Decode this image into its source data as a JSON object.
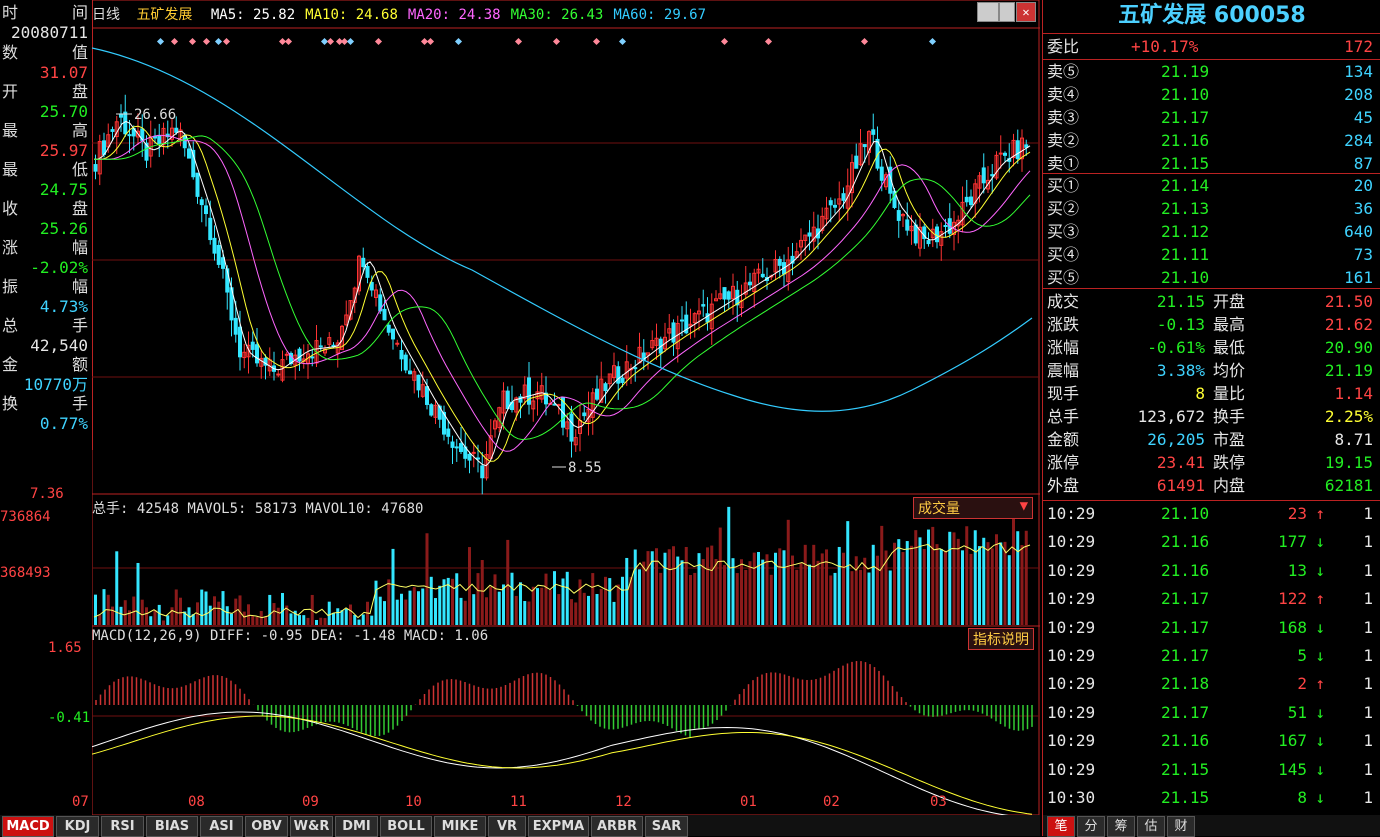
{
  "header": {
    "period": "日线",
    "stock_name": "五矿发展",
    "ma": [
      {
        "label": "MA5: 25.82",
        "color": "#ffffff"
      },
      {
        "label": "MA10: 24.68",
        "color": "#ffff33"
      },
      {
        "label": "MA20: 24.38",
        "color": "#ff66ff"
      },
      {
        "label": "MA30: 26.43",
        "color": "#33ff33"
      },
      {
        "label": "MA60: 29.67",
        "color": "#33ccff"
      }
    ]
  },
  "left_info": {
    "date_label": "时",
    "date_label2": "间",
    "date": "20080711",
    "rows": [
      {
        "lab": "数",
        "lab2": "值",
        "val": "",
        "color": "#ddd"
      },
      {
        "lab": "",
        "lab2": "",
        "val": "31.07",
        "color": "#ff4444"
      },
      {
        "lab": "开",
        "lab2": "盘",
        "val": "",
        "color": "#ddd"
      },
      {
        "lab": "",
        "lab2": "",
        "val": "25.70",
        "color": "#22ee22"
      },
      {
        "lab": "最",
        "lab2": "高",
        "val": "",
        "color": "#ddd"
      },
      {
        "lab": "",
        "lab2": "",
        "val": "25.97",
        "color": "#ff4444"
      },
      {
        "lab": "最",
        "lab2": "低",
        "val": "",
        "color": "#ddd"
      },
      {
        "lab": "",
        "lab2": "",
        "val": "24.75",
        "color": "#22ee22"
      },
      {
        "lab": "收",
        "lab2": "盘",
        "val": "",
        "color": "#ddd"
      },
      {
        "lab": "",
        "lab2": "",
        "val": "25.26",
        "color": "#22ee22"
      },
      {
        "lab": "涨",
        "lab2": "幅",
        "val": "",
        "color": "#ddd"
      },
      {
        "lab": "",
        "lab2": "",
        "val": "-2.02%",
        "color": "#22ee22"
      },
      {
        "lab": "振",
        "lab2": "幅",
        "val": "",
        "color": "#ddd"
      },
      {
        "lab": "",
        "lab2": "",
        "val": "4.73%",
        "color": "#3fd3ff"
      },
      {
        "lab": "总",
        "lab2": "手",
        "val": "",
        "color": "#ddd"
      },
      {
        "lab": "",
        "lab2": "",
        "val": "42,540",
        "color": "#e6e6e6"
      },
      {
        "lab": "金",
        "lab2": "额",
        "val": "",
        "color": "#ddd"
      },
      {
        "lab": "",
        "lab2": "",
        "val": "10770万",
        "color": "#3fd3ff"
      },
      {
        "lab": "换",
        "lab2": "手",
        "val": "",
        "color": "#ddd"
      },
      {
        "lab": "",
        "lab2": "",
        "val": "0.77%",
        "color": "#3fd3ff"
      }
    ]
  },
  "price_chart": {
    "high_mark": "26.66",
    "low_mark": "8.55",
    "y_bottom_label": "7.36"
  },
  "volume": {
    "legend": "总手: 42548  MAVOL5: 58173  MAVOL10: 47680",
    "selector": "成交量",
    "ticks": [
      "736864",
      "368493"
    ]
  },
  "macd": {
    "legend": "MACD(12,26,9)  DIFF: -0.95  DEA: -1.48  MACD: 1.06",
    "button": "指标说明",
    "ticks": [
      "1.65",
      "-0.41"
    ]
  },
  "x_axis": [
    "07",
    "08",
    "09",
    "10",
    "11",
    "12",
    "01",
    "02",
    "03"
  ],
  "tabs": [
    "MACD",
    "KDJ",
    "RSI",
    "BIAS",
    "ASI",
    "OBV",
    "W&R",
    "DMI",
    "BOLL",
    "MIKE",
    "VR",
    "EXPMA",
    "ARBR",
    "SAR"
  ],
  "right_panel": {
    "title": "五矿发展 600058",
    "wei": {
      "label": "委比",
      "pct": "+10.17%",
      "vol": "172"
    },
    "sell": [
      {
        "label": "卖⑤",
        "price": "21.19",
        "vol": "134"
      },
      {
        "label": "卖④",
        "price": "21.10",
        "vol": "208"
      },
      {
        "label": "卖③",
        "price": "21.17",
        "vol": "45"
      },
      {
        "label": "卖②",
        "price": "21.16",
        "vol": "284"
      },
      {
        "label": "卖①",
        "price": "21.15",
        "vol": "87"
      }
    ],
    "buy": [
      {
        "label": "买①",
        "price": "21.14",
        "vol": "20"
      },
      {
        "label": "买②",
        "price": "21.13",
        "vol": "36"
      },
      {
        "label": "买③",
        "price": "21.12",
        "vol": "640"
      },
      {
        "label": "买④",
        "price": "21.11",
        "vol": "73"
      },
      {
        "label": "买⑤",
        "price": "21.10",
        "vol": "161"
      }
    ],
    "stats": [
      {
        "l1": "成交",
        "v1": "21.15",
        "c1": "#22ee22",
        "l2": "开盘",
        "v2": "21.50",
        "c2": "#ff4444"
      },
      {
        "l1": "涨跌",
        "v1": "-0.13",
        "c1": "#22ee22",
        "l2": "最高",
        "v2": "21.62",
        "c2": "#ff4444"
      },
      {
        "l1": "涨幅",
        "v1": "-0.61%",
        "c1": "#22ee22",
        "l2": "最低",
        "v2": "20.90",
        "c2": "#22ee22"
      },
      {
        "l1": "震幅",
        "v1": "3.38%",
        "c1": "#3fd3ff",
        "l2": "均价",
        "v2": "21.19",
        "c2": "#22ee22"
      },
      {
        "l1": "现手",
        "v1": "8",
        "c1": "#ffff33",
        "l2": "量比",
        "v2": "1.14",
        "c2": "#ff4444"
      },
      {
        "l1": "总手",
        "v1": "123,672",
        "c1": "#e6e6e6",
        "l2": "换手",
        "v2": "2.25%",
        "c2": "#ffff33"
      },
      {
        "l1": "金额",
        "v1": "26,205",
        "c1": "#3fd3ff",
        "l2": "市盈",
        "v2": "8.71",
        "c2": "#e6e6e6"
      },
      {
        "l1": "涨停",
        "v1": "23.41",
        "c1": "#ff4444",
        "l2": "跌停",
        "v2": "19.15",
        "c2": "#22ee22"
      },
      {
        "l1": "外盘",
        "v1": "61491",
        "c1": "#ff4444",
        "l2": "内盘",
        "v2": "62181",
        "c2": "#22ee22"
      }
    ],
    "ticks": [
      {
        "time": "10:29",
        "price": "21.10",
        "vol": "23",
        "dir": "up",
        "n": "1"
      },
      {
        "time": "10:29",
        "price": "21.16",
        "vol": "177",
        "dir": "down",
        "n": "1"
      },
      {
        "time": "10:29",
        "price": "21.16",
        "vol": "13",
        "dir": "down",
        "n": "1"
      },
      {
        "time": "10:29",
        "price": "21.17",
        "vol": "122",
        "dir": "up",
        "n": "1"
      },
      {
        "time": "10:29",
        "price": "21.17",
        "vol": "168",
        "dir": "down",
        "n": "1"
      },
      {
        "time": "10:29",
        "price": "21.17",
        "vol": "5",
        "dir": "down",
        "n": "1"
      },
      {
        "time": "10:29",
        "price": "21.18",
        "vol": "2",
        "dir": "up",
        "n": "1"
      },
      {
        "time": "10:29",
        "price": "21.17",
        "vol": "51",
        "dir": "down",
        "n": "1"
      },
      {
        "time": "10:29",
        "price": "21.16",
        "vol": "167",
        "dir": "down",
        "n": "1"
      },
      {
        "time": "10:29",
        "price": "21.15",
        "vol": "145",
        "dir": "down",
        "n": "1"
      },
      {
        "time": "10:30",
        "price": "21.15",
        "vol": "8",
        "dir": "down",
        "n": "1"
      }
    ],
    "bottom_tabs": [
      "笔",
      "分",
      "筹",
      "估",
      "财"
    ]
  },
  "chart_data": {
    "type": "candlestick",
    "x_labels": [
      "07",
      "08",
      "09",
      "10",
      "11",
      "12",
      "01",
      "02",
      "03"
    ],
    "price_annotations": {
      "high": 26.66,
      "low": 8.55
    },
    "series": [
      {
        "name": "MA5",
        "values": [
          25.82
        ]
      },
      {
        "name": "MA10",
        "values": [
          24.68
        ]
      },
      {
        "name": "MA20",
        "values": [
          24.38
        ]
      },
      {
        "name": "MA30",
        "values": [
          26.43
        ]
      },
      {
        "name": "MA60",
        "values": [
          29.67
        ]
      }
    ],
    "volume": {
      "total": 42548,
      "mavol5": 58173,
      "mavol10": 47680,
      "ticks": [
        736864,
        368493
      ]
    },
    "macd": {
      "diff": -0.95,
      "dea": -1.48,
      "macd": 1.06,
      "ticks": [
        1.65,
        -0.41
      ]
    }
  }
}
